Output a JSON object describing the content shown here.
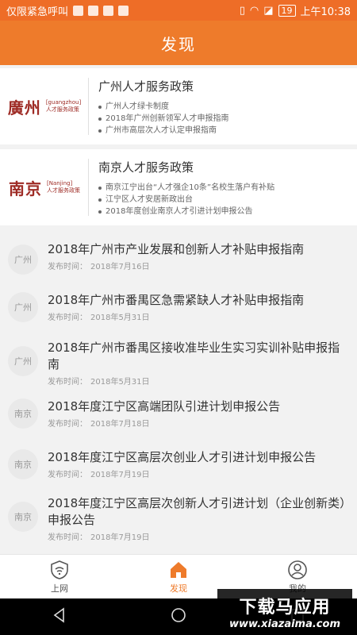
{
  "status": {
    "carrier": "仅限紧急呼叫",
    "battery": "19",
    "time": "上午10:38"
  },
  "header": {
    "title": "发现"
  },
  "policies": [
    {
      "logo_text": "廣州",
      "logo_en": "[guangzhou]",
      "logo_sub": "人才服务政策",
      "title": "广州人才服务政策",
      "items": [
        "广州人才绿卡制度",
        "2018年广州创新领军人才申报指南",
        "广州市高层次人才认定申报指南"
      ]
    },
    {
      "logo_text": "南京",
      "logo_en": "[Nanjing]",
      "logo_sub": "人才服务政策",
      "title": "南京人才服务政策",
      "items": [
        "南京江宁出台“人才强企10条”名校生落户有补贴",
        "江宁区人才安居新政出台",
        "2018年度创业南京人才引进计划申报公告"
      ]
    }
  ],
  "news": [
    {
      "city": "广州",
      "title": "2018年广州市产业发展和创新人才补贴申报指南",
      "meta_label": "发布时间：",
      "date": "2018年7月16日"
    },
    {
      "city": "广州",
      "title": "2018年广州市番禺区急需紧缺人才补贴申报指南",
      "meta_label": "发布时间：",
      "date": "2018年5月31日"
    },
    {
      "city": "广州",
      "title": "2018年广州市番禺区接收准毕业生实习实训补贴申报指南",
      "meta_label": "发布时间：",
      "date": "2018年5月31日"
    },
    {
      "city": "南京",
      "title": "2018年度江宁区高端团队引进计划申报公告",
      "meta_label": "发布时间：",
      "date": "2018年7月18日"
    },
    {
      "city": "南京",
      "title": "2018年度江宁区高层次创业人才引进计划申报公告",
      "meta_label": "发布时间：",
      "date": "2018年7月19日"
    },
    {
      "city": "南京",
      "title": "2018年度江宁区高层次创新人才引进计划（企业创新类）申报公告",
      "meta_label": "发布时间：",
      "date": "2018年7月19日"
    }
  ],
  "tabs": [
    {
      "label": "上网",
      "icon": "shield-wifi-icon"
    },
    {
      "label": "发现",
      "icon": "home-icon"
    },
    {
      "label": "我的",
      "icon": "user-icon"
    }
  ],
  "watermark": {
    "line1": "下载马应用",
    "line2": "www.xiazaima.com"
  },
  "colors": {
    "accent": "#ee7b2b",
    "logo_red": "#9e2b25"
  }
}
